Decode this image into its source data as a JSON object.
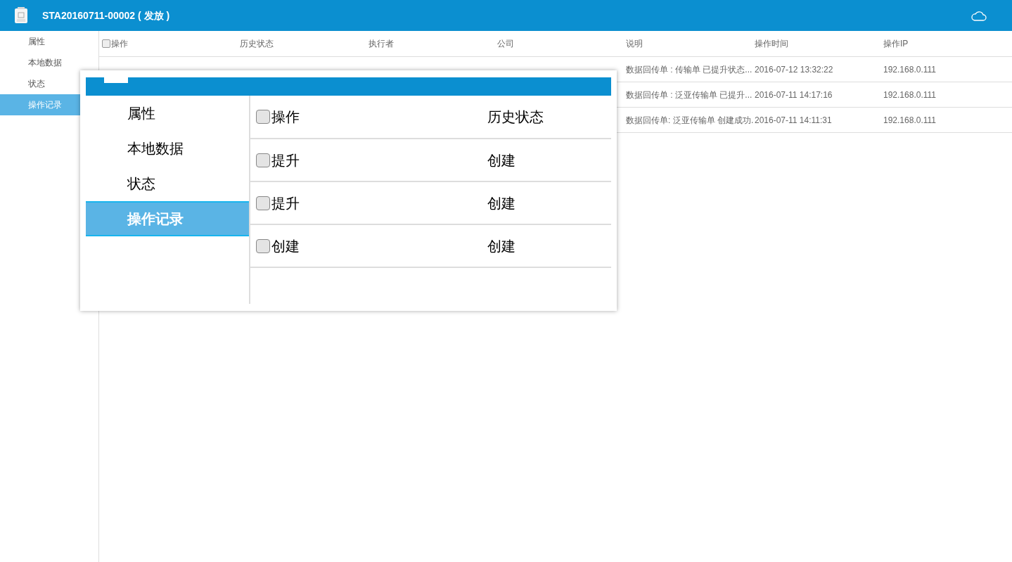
{
  "header": {
    "title": "STA20160711-00002 ( 发放 )"
  },
  "sidebar": {
    "items": [
      {
        "label": "属性",
        "selected": false
      },
      {
        "label": "本地数据",
        "selected": false
      },
      {
        "label": "状态",
        "selected": false
      },
      {
        "label": "操作记录",
        "selected": true
      }
    ]
  },
  "table": {
    "select_all_checked": false,
    "columns": [
      "操作",
      "历史状态",
      "执行者",
      "公司",
      "说明",
      "操作时间",
      "操作IP"
    ],
    "rows": [
      {
        "cells": [
          null,
          null,
          null,
          null,
          "数据回传单 : 传输单 已提升状态...",
          "2016-07-12 13:32:22",
          "192.168.0.111"
        ]
      },
      {
        "cells": [
          null,
          null,
          null,
          null,
          "数据回传单 : 泛亚传输单 已提升...",
          "2016-07-11 14:17:16",
          "192.168.0.111"
        ]
      },
      {
        "cells": [
          null,
          null,
          null,
          null,
          "数据回传单: 泛亚传输单 创建成功.",
          "2016-07-11 14:11:31",
          "192.168.0.111"
        ]
      }
    ]
  },
  "magnifier": {
    "sidebar": {
      "items": [
        {
          "label": "属性",
          "selected": false
        },
        {
          "label": "本地数据",
          "selected": false
        },
        {
          "label": "状态",
          "selected": false
        },
        {
          "label": "操作记录",
          "selected": true
        }
      ]
    },
    "table": {
      "select_all_checked": false,
      "columns": [
        "操作",
        "历史状态"
      ],
      "rows": [
        {
          "checked": false,
          "cells": [
            "提升",
            "创建"
          ]
        },
        {
          "checked": false,
          "cells": [
            "提升",
            "创建"
          ]
        },
        {
          "checked": false,
          "cells": [
            "创建",
            "创建"
          ]
        }
      ]
    }
  }
}
